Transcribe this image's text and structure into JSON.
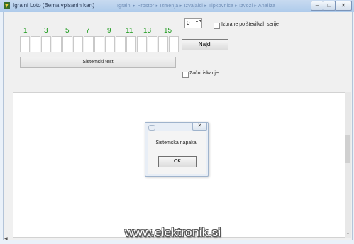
{
  "window": {
    "title": "Igralni Loto (Bema vpisanih kart)",
    "background_taskbar": "Igralni ▸ Prostor ▸ Izmenja ▸ Izvajalci ▸ Tipkovnica ▸ Izvozi ▸ Analiza",
    "minimize_glyph": "–",
    "maximize_glyph": "□",
    "close_glyph": "✕"
  },
  "numbers": [
    "1",
    "3",
    "5",
    "7",
    "9",
    "11",
    "13",
    "15"
  ],
  "spinner": {
    "value": "0",
    "arrows": "▲▼"
  },
  "checkbox_top": {
    "label": "Izbrane po številkah serije",
    "checked": false
  },
  "checkbox_bottom": {
    "label": "Začni iskanje",
    "checked": false
  },
  "start_button": {
    "label": "Najdi"
  },
  "system_button": {
    "label": "Sistemski test"
  },
  "dialog": {
    "message": "Sistemska napaka!",
    "ok_label": "OK",
    "close_glyph": "✕"
  },
  "watermark": "www.elektronik.si",
  "colors": {
    "number_green": "#1a9a1a",
    "titlebar": "#aecbeb"
  },
  "icons": {
    "app": "app-icon",
    "dialog": "dialog-icon"
  }
}
